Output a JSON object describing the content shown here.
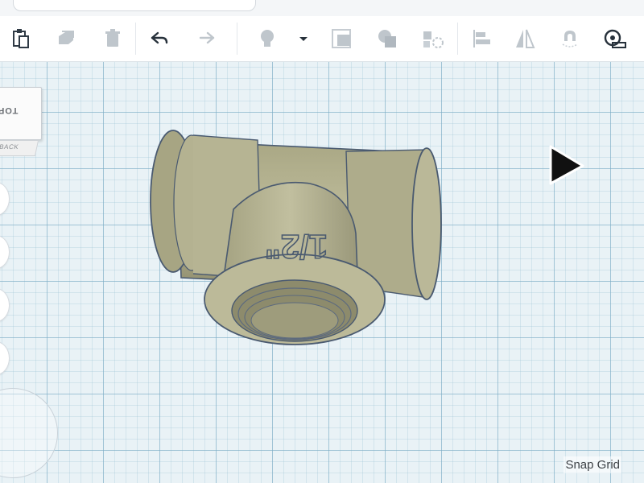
{
  "toolbar": {
    "buttons": [
      {
        "icon": "paste-icon",
        "enabled": true
      },
      {
        "icon": "duplicate-icon",
        "enabled": false
      },
      {
        "icon": "delete-icon",
        "enabled": false
      },
      {
        "icon": "undo-icon",
        "enabled": true
      },
      {
        "icon": "redo-icon",
        "enabled": false
      },
      {
        "icon": "lightbulb-icon",
        "enabled": false
      },
      {
        "icon": "dropdown-caret-icon",
        "enabled": true
      },
      {
        "icon": "group-icon",
        "enabled": false
      },
      {
        "icon": "ungroup-icon",
        "enabled": false
      },
      {
        "icon": "align-icon",
        "enabled": false
      },
      {
        "icon": "mirror-icon",
        "enabled": false
      },
      {
        "icon": "magnet-icon",
        "enabled": false
      },
      {
        "icon": "ruler-icon",
        "enabled": true
      }
    ]
  },
  "viewcube": {
    "top_label": "TOP",
    "back_label": "BACK"
  },
  "model": {
    "name_label": "1/2\"",
    "color": "#b9b796"
  },
  "footer": {
    "snap_grid_label": "Snap Grid"
  },
  "colors": {
    "accent": "#2c6fb3",
    "icon_active": "#27313b",
    "icon_disabled": "#b7bec5"
  }
}
